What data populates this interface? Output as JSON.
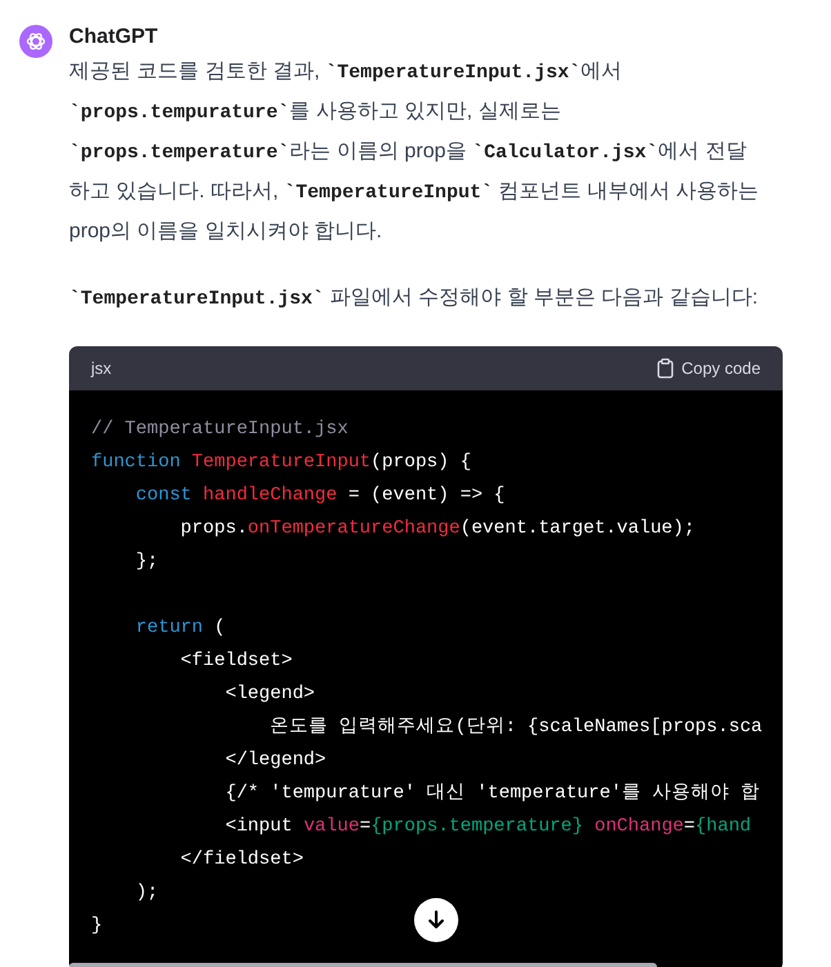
{
  "message": {
    "author": "ChatGPT",
    "paragraphs": [
      [
        {
          "kind": "text",
          "text": "제공된 코드를 검토한 결과, "
        },
        {
          "kind": "code",
          "text": "`TemperatureInput.jsx`"
        },
        {
          "kind": "text",
          "text": "에서 "
        },
        {
          "kind": "code",
          "text": "`props.tempurature`"
        },
        {
          "kind": "text",
          "text": "를 사용하고 있지만, 실제로는 "
        },
        {
          "kind": "code",
          "text": "`props.temperature`"
        },
        {
          "kind": "text",
          "text": "라는 이름의 prop을 "
        },
        {
          "kind": "code",
          "text": "`Calculator.jsx`"
        },
        {
          "kind": "text",
          "text": "에서 전달하고 있습니다. 따라서, "
        },
        {
          "kind": "code",
          "text": "`TemperatureInput`"
        },
        {
          "kind": "text",
          "text": " 컴포넌트 내부에서 사용하는 prop의 이름을 일치시켜야 합니다."
        }
      ],
      [
        {
          "kind": "code",
          "text": "`TemperatureInput.jsx`"
        },
        {
          "kind": "text",
          "text": " 파일에서 수정해야 할 부분은 다음과 같습니다:"
        }
      ]
    ],
    "code_block": {
      "language": "jsx",
      "copy_label": "Copy code",
      "lines": [
        {
          "tokens": [
            {
              "kind": "comment",
              "text": "// TemperatureInput.jsx"
            }
          ]
        },
        {
          "tokens": [
            {
              "kind": "keyword",
              "text": "function"
            },
            {
              "kind": "name",
              "text": " TemperatureInput"
            },
            {
              "kind": "plain",
              "text": "(props) {"
            }
          ]
        },
        {
          "tokens": [
            {
              "kind": "keyword",
              "text": "    const"
            },
            {
              "kind": "name",
              "text": " handleChange"
            },
            {
              "kind": "plain",
              "text": " = (event) => {"
            }
          ]
        },
        {
          "tokens": [
            {
              "kind": "plain",
              "text": "        props."
            },
            {
              "kind": "name",
              "text": "onTemperatureChange"
            },
            {
              "kind": "plain",
              "text": "(event.target.value);"
            }
          ]
        },
        {
          "tokens": [
            {
              "kind": "plain",
              "text": "    };"
            }
          ]
        },
        {
          "kind": "blank"
        },
        {
          "tokens": [
            {
              "kind": "keyword",
              "text": "    return"
            },
            {
              "kind": "plain",
              "text": " ("
            }
          ]
        },
        {
          "tokens": [
            {
              "kind": "plain",
              "text": "        <fieldset>"
            }
          ]
        },
        {
          "tokens": [
            {
              "kind": "plain",
              "text": "            <legend>"
            }
          ]
        },
        {
          "tokens": [
            {
              "kind": "plain",
              "text": "                온도를 입력해주세요(단위: {scaleNames[props.sca"
            }
          ]
        },
        {
          "tokens": [
            {
              "kind": "plain",
              "text": "            </legend>"
            }
          ]
        },
        {
          "tokens": [
            {
              "kind": "plain",
              "text": "            {/* 'tempurature' 대신 'temperature'를 사용해야 합"
            }
          ]
        },
        {
          "tokens": [
            {
              "kind": "plain",
              "text": "            <input "
            },
            {
              "kind": "attr",
              "text": "value"
            },
            {
              "kind": "plain",
              "text": "="
            },
            {
              "kind": "string",
              "text": "{props.temperature}"
            },
            {
              "kind": "attr",
              "text": " onChange"
            },
            {
              "kind": "plain",
              "text": "="
            },
            {
              "kind": "string",
              "text": "{hand"
            }
          ]
        },
        {
          "tokens": [
            {
              "kind": "plain",
              "text": "        </fieldset>"
            }
          ]
        },
        {
          "tokens": [
            {
              "kind": "plain",
              "text": "    );"
            }
          ]
        },
        {
          "tokens": [
            {
              "kind": "plain",
              "text": "}"
            }
          ]
        }
      ]
    }
  }
}
